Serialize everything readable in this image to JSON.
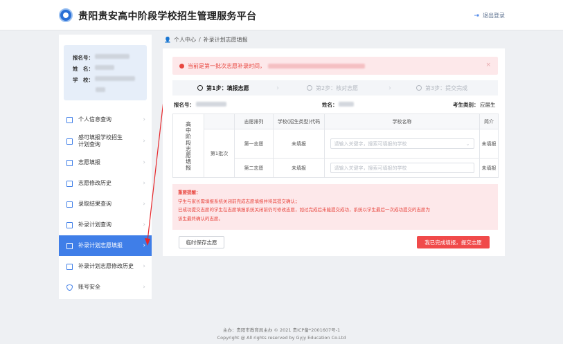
{
  "header": {
    "title": "贵阳贵安高中阶段学校招生管理服务平台",
    "logout_label": "退出登录"
  },
  "profile": {
    "reg_label": "报名号：",
    "name_label": "姓　名：",
    "school_label": "学　校："
  },
  "sidebar": {
    "items": [
      {
        "label": "个人信息查询",
        "icon": "id-card-icon"
      },
      {
        "label": "感可填报学校招生计划查询",
        "icon": "school-icon"
      },
      {
        "label": "志愿填报",
        "icon": "pencil-icon"
      },
      {
        "label": "志愿修改历史",
        "icon": "edit-icon"
      },
      {
        "label": "录取结果查询",
        "icon": "search-doc-icon"
      },
      {
        "label": "补录计划查询",
        "icon": "plan-icon"
      },
      {
        "label": "补录计划志愿填报",
        "icon": "form-icon"
      },
      {
        "label": "补录计划志愿修改历史",
        "icon": "history-icon"
      },
      {
        "label": "账号安全",
        "icon": "shield-icon"
      }
    ],
    "active_index": 6
  },
  "breadcrumb": {
    "home": "个人中心",
    "separator": "/",
    "current": "补录计划志愿填报"
  },
  "alert": {
    "text": "当前是第一批次志愿补录时间，"
  },
  "steps": [
    {
      "label": "第1步：填报志愿",
      "state": "current"
    },
    {
      "label": "第2步：核对志愿",
      "state": "pending"
    },
    {
      "label": "第3步：提交完成",
      "state": "pending"
    }
  ],
  "student": {
    "reg_label": "报名号：",
    "name_label": "姓名：",
    "type_label": "考生类别：",
    "type_value": "应届生"
  },
  "table": {
    "side_label": "高中阶段志愿填报",
    "headers": [
      "志愿排列",
      "学校(招生类型)代码",
      "学校名称",
      "简介"
    ],
    "batch_label": "第1批次",
    "rows": [
      {
        "order": "第一志愿",
        "code": "未填报",
        "placeholder": "请输入关键字，搜索可填报的学校",
        "intro": "未填报"
      },
      {
        "order": "第二志愿",
        "code": "未填报",
        "placeholder": "请输入关键字，搜索可填报的学校",
        "intro": "未填报"
      }
    ]
  },
  "notice": {
    "title": "重要提醒：",
    "lines": [
      "学生与家长需填报系统关闭前完成志愿填报并将其提交确认；",
      "已成功提交志愿的学生在志愿填报系统关闭前仍可修改志愿，如过完成后未能提交成功，系统以学生最后一次成功提交的志愿为",
      "该生最终确认的志愿。"
    ]
  },
  "buttons": {
    "draft": "临时保存志愿",
    "submit": "我已完成填报，提交志愿"
  },
  "footer": {
    "line1": "主办：贵阳市教育局主办 © 2021 贵ICP备*2001607号-1",
    "line2": "Copyright @ All rights reserved by Gyjy Education Co.Ltd"
  },
  "colors": {
    "primary": "#3f7ee8",
    "danger": "#f04a4a",
    "alert_bg": "#fde8ea"
  }
}
